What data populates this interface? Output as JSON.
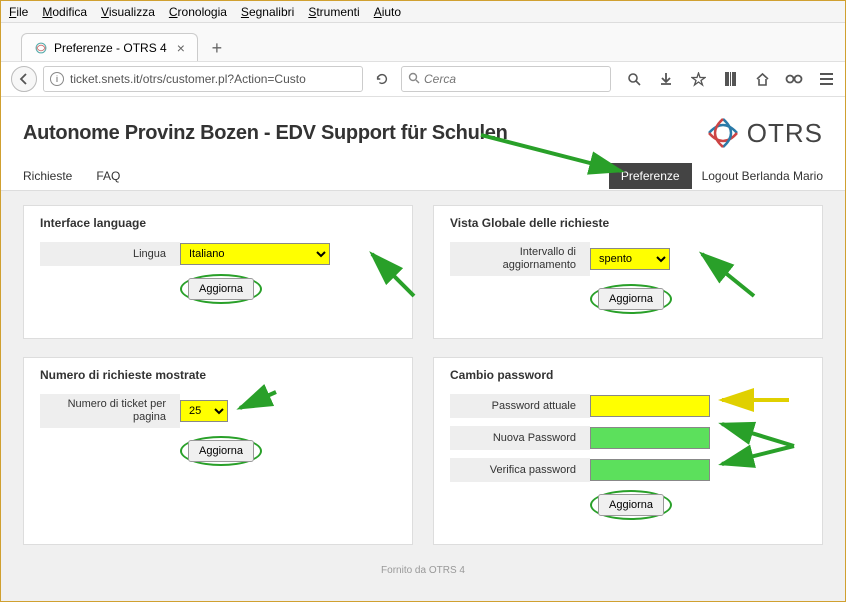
{
  "menubar": [
    "File",
    "Modifica",
    "Visualizza",
    "Cronologia",
    "Segnalibri",
    "Strumenti",
    "Aiuto"
  ],
  "tab": {
    "title": "Preferenze - OTRS 4"
  },
  "url": "ticket.snets.it/otrs/customer.pl?Action=Custo",
  "search_placeholder": "Cerca",
  "page_title": "Autonome Provinz Bozen - EDV Support für Schulen",
  "logo_text": "OTRS",
  "nav": {
    "r": "Richieste",
    "f": "FAQ",
    "pref": "Preferenze",
    "logout": "Logout Berlanda Mario"
  },
  "panels": {
    "lang": {
      "title": "Interface language",
      "label": "Lingua",
      "value": "Italiano",
      "btn": "Aggiorna"
    },
    "refresh": {
      "title": "Vista Globale delle richieste",
      "label": "Intervallo di aggiornamento",
      "value": "spento",
      "btn": "Aggiorna"
    },
    "count": {
      "title": "Numero di richieste mostrate",
      "label": "Numero di ticket per pagina",
      "value": "25",
      "btn": "Aggiorna"
    },
    "pwd": {
      "title": "Cambio password",
      "cur": "Password attuale",
      "new": "Nuova Password",
      "ver": "Verifica password",
      "btn": "Aggiorna"
    }
  },
  "footer": "Fornito da OTRS 4"
}
